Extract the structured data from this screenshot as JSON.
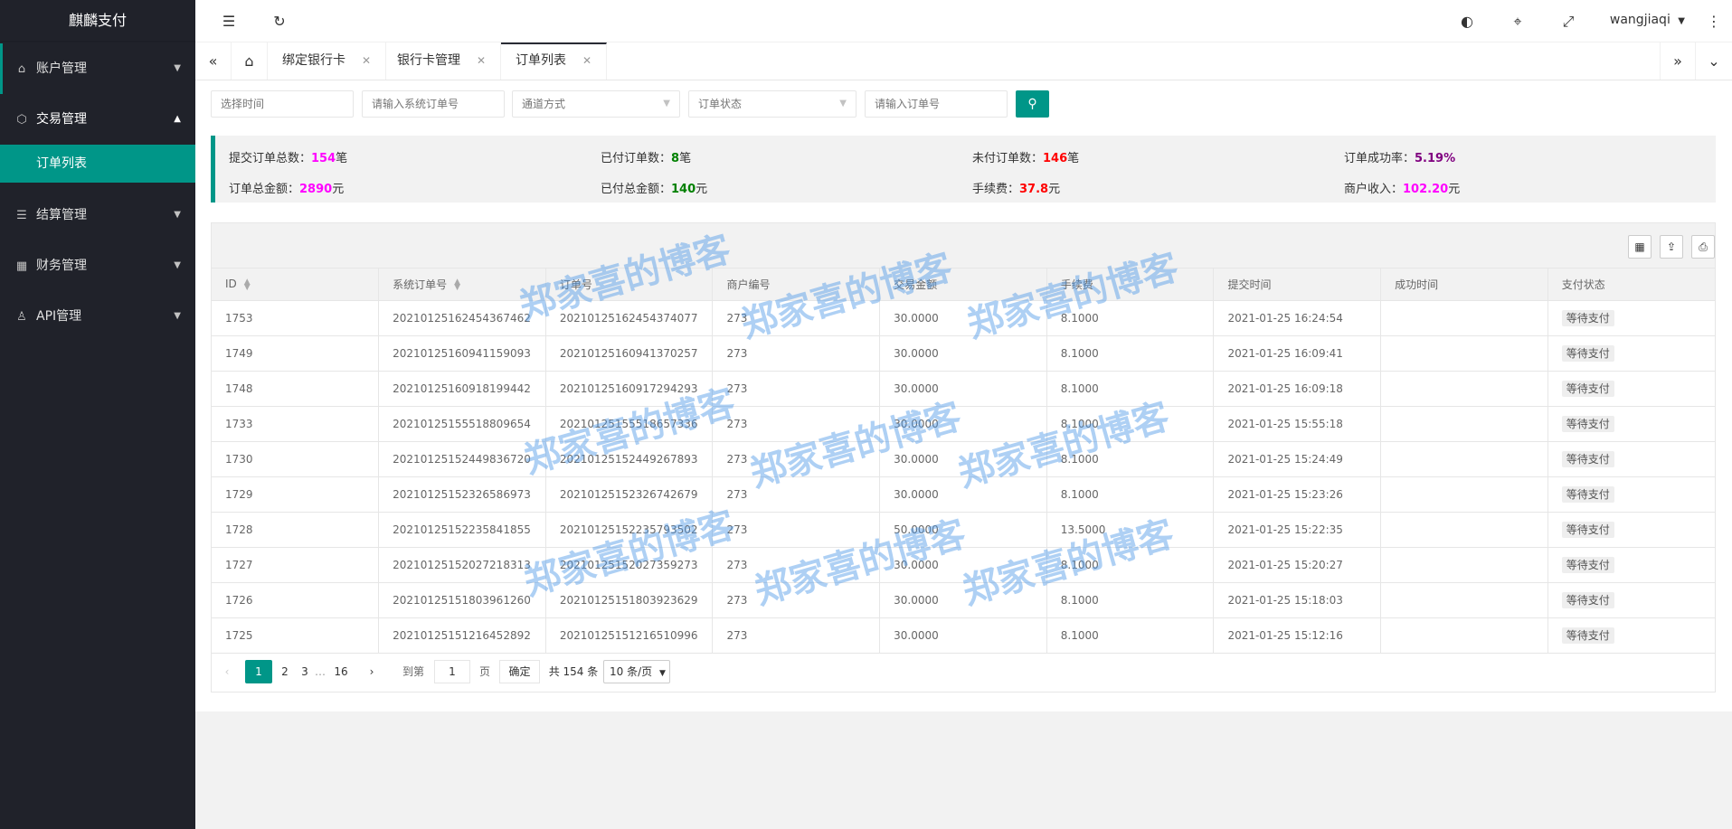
{
  "app": {
    "brand": "麒麟支付"
  },
  "sidebar": {
    "items": [
      {
        "label": "账户管理",
        "icon": "home-icon"
      },
      {
        "label": "交易管理",
        "icon": "cube-icon",
        "children": [
          {
            "label": "订单列表"
          }
        ]
      },
      {
        "label": "结算管理",
        "icon": "list-icon"
      },
      {
        "label": "财务管理",
        "icon": "apps-icon"
      },
      {
        "label": "API管理",
        "icon": "user-icon"
      }
    ]
  },
  "header": {
    "user": "wangjiaqi"
  },
  "tabs": [
    {
      "label": "绑定银行卡"
    },
    {
      "label": "银行卡管理"
    },
    {
      "label": "订单列表"
    }
  ],
  "filters": {
    "time_placeholder": "选择时间",
    "sys_order_placeholder": "请输入系统订单号",
    "channel_placeholder": "通道方式",
    "status_placeholder": "订单状态",
    "order_placeholder": "请输入订单号"
  },
  "stats": {
    "submitted_label": "提交订单总数：",
    "submitted_value": "154",
    "submitted_unit": "笔",
    "paid_label": "已付订单数：",
    "paid_value": "8",
    "paid_unit": "笔",
    "unpaid_label": "未付订单数：",
    "unpaid_value": "146",
    "unpaid_unit": "笔",
    "rate_label": "订单成功率：",
    "rate_value": "5.19%",
    "total_amount_label": "订单总金额：",
    "total_amount_value": "2890",
    "total_amount_unit": "元",
    "paid_amount_label": "已付总金额：",
    "paid_amount_value": "140",
    "paid_amount_unit": "元",
    "fee_label": "手续费：",
    "fee_value": "37.8",
    "fee_unit": "元",
    "income_label": "商户收入：",
    "income_value": "102.20",
    "income_unit": "元"
  },
  "colors": {
    "accent": "#009688",
    "magenta": "#ff00ff",
    "green": "#008000",
    "red": "#ff0000",
    "purple": "#800080"
  },
  "table": {
    "columns": [
      "ID",
      "系统订单号",
      "订单号",
      "商户编号",
      "交易金额",
      "手续费",
      "提交时间",
      "成功时间",
      "支付状态"
    ],
    "rows": [
      [
        "1753",
        "20210125162454367462",
        "20210125162454374077",
        "273",
        "30.0000",
        "8.1000",
        "2021-01-25 16:24:54",
        "",
        "等待支付"
      ],
      [
        "1749",
        "20210125160941159093",
        "20210125160941370257",
        "273",
        "30.0000",
        "8.1000",
        "2021-01-25 16:09:41",
        "",
        "等待支付"
      ],
      [
        "1748",
        "20210125160918199442",
        "20210125160917294293",
        "273",
        "30.0000",
        "8.1000",
        "2021-01-25 16:09:18",
        "",
        "等待支付"
      ],
      [
        "1733",
        "20210125155518809654",
        "20210125155518657336",
        "273",
        "30.0000",
        "8.1000",
        "2021-01-25 15:55:18",
        "",
        "等待支付"
      ],
      [
        "1730",
        "20210125152449836720",
        "20210125152449267893",
        "273",
        "30.0000",
        "8.1000",
        "2021-01-25 15:24:49",
        "",
        "等待支付"
      ],
      [
        "1729",
        "20210125152326586973",
        "20210125152326742679",
        "273",
        "30.0000",
        "8.1000",
        "2021-01-25 15:23:26",
        "",
        "等待支付"
      ],
      [
        "1728",
        "20210125152235841855",
        "20210125152235793502",
        "273",
        "50.0000",
        "13.5000",
        "2021-01-25 15:22:35",
        "",
        "等待支付"
      ],
      [
        "1727",
        "20210125152027218313",
        "20210125152027359273",
        "273",
        "30.0000",
        "8.1000",
        "2021-01-25 15:20:27",
        "",
        "等待支付"
      ],
      [
        "1726",
        "20210125151803961260",
        "20210125151803923629",
        "273",
        "30.0000",
        "8.1000",
        "2021-01-25 15:18:03",
        "",
        "等待支付"
      ],
      [
        "1725",
        "20210125151216452892",
        "20210125151216510996",
        "273",
        "30.0000",
        "8.1000",
        "2021-01-25 15:12:16",
        "",
        "等待支付"
      ]
    ]
  },
  "pager": {
    "pages": [
      "1",
      "2",
      "3",
      "…",
      "16"
    ],
    "goto_label": "到第",
    "goto_value": "1",
    "page_label": "页",
    "confirm": "确定",
    "total": "共 154 条",
    "page_size": "10 条/页"
  },
  "watermark": "郑家喜的博客"
}
